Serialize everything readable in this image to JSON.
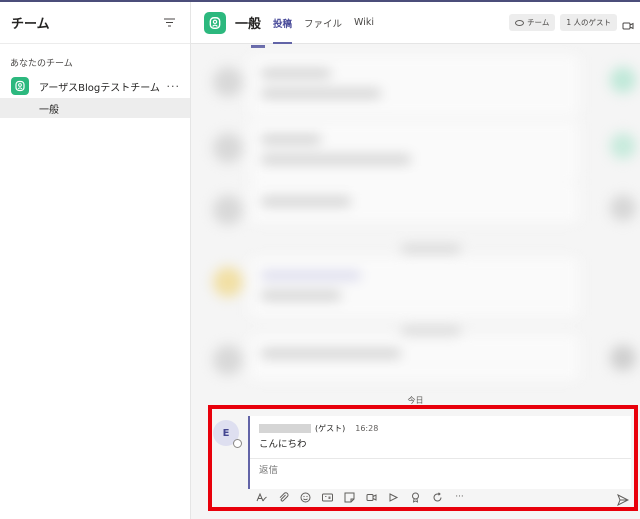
{
  "sidebar": {
    "title": "チーム",
    "section_label": "あなたのチーム",
    "team_name": "アーザスBlogテストチーム",
    "team_more": "···",
    "channel_name": "一般"
  },
  "channel": {
    "title": "一般",
    "tabs": [
      {
        "label": "投稿",
        "active": true
      },
      {
        "label": "ファイル",
        "active": false
      },
      {
        "label": "Wiki",
        "active": false
      }
    ],
    "team_pill": "チーム",
    "guest_pill": "1 人のゲスト"
  },
  "feed": {
    "date_divider": "今日"
  },
  "message": {
    "avatar_initial": "E",
    "guest_label": "(ゲスト)",
    "time": "16:28",
    "body": "こんにちわ",
    "reply_placeholder": "返信"
  },
  "toolbar": {
    "icons": [
      "format-icon",
      "attach-icon",
      "emoji-icon",
      "gif-icon",
      "sticker-icon",
      "meet-icon",
      "stream-icon",
      "praise-icon",
      "loop-icon",
      "more-icon"
    ],
    "more_label": "···"
  },
  "colors": {
    "accent": "#6264a7",
    "team_green": "#2cb87e",
    "highlight_red": "#e8000b"
  }
}
